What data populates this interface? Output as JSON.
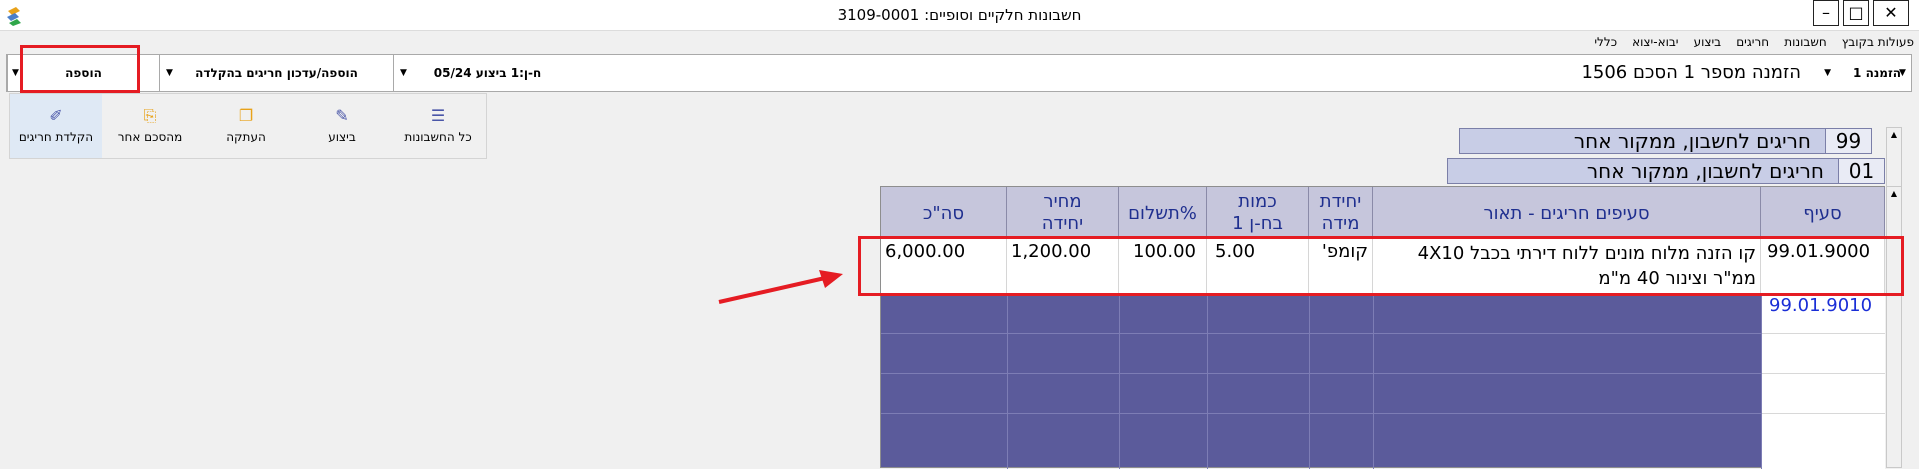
{
  "window": {
    "title": "חשבונות חלקיים וסופיים: 3109-0001",
    "minimize_glyph": "–",
    "maximize_glyph": "□",
    "close_glyph": "✕"
  },
  "menu": [
    "פעולות בקובץ",
    "חשבונות",
    "חריגים",
    "ביצוע",
    "יבוא-יצוא",
    "כללי"
  ],
  "toolbar": {
    "order_label": "הזמנה 1",
    "order_text": "הזמנה מספר 1 הסכם 1506",
    "period_label": "ח-ן:1 ביצוע 05/24",
    "mode_label": "הוספה/עדכון חריגים בהקלדה",
    "action_label": "הוספה"
  },
  "icon_buttons": [
    {
      "label": "כל החשבונות",
      "icon": "list-icon"
    },
    {
      "label": "ביצוע",
      "icon": "edit-list-icon"
    },
    {
      "label": "העתקה",
      "icon": "copy-icon"
    },
    {
      "label": "מהסכם אחר",
      "icon": "import-icon"
    },
    {
      "label": "הקלדת חריגים",
      "icon": "pencil-list-icon"
    }
  ],
  "accounts": [
    {
      "code": "99",
      "name": "חריגים לחשבון, ממקור אחר"
    },
    {
      "code": "01",
      "name": "חריגים לחשבון, ממקור אחר"
    }
  ],
  "table": {
    "headers": {
      "section": "סעיף",
      "description": "סעיפים חריגים - תאור",
      "unit": "יחידת\nמידה",
      "qty": "כמות\nבח-ן 1",
      "pay": "%תשלום",
      "price": "מחיר\nיחידה",
      "total": "סה\"כ"
    },
    "row": {
      "section": "99.01.9000",
      "description": "קו הזנה מלוח מונים ללוח דירתי בכבל 4X10 ממ\"ר וצינור 40 מ\"מ",
      "unit": "קומפ'",
      "qty": "5.00",
      "pay": "100.00",
      "price": "1,200.00",
      "total": "6,000.00"
    },
    "next_section": "99.01.9010"
  },
  "colors": {
    "highlight": "#e51c23",
    "grid_fill": "#5b5b9b",
    "header_fill": "#c6c6dc",
    "header_text": "#1f2f8f",
    "link_blue": "#1a2ed6"
  }
}
